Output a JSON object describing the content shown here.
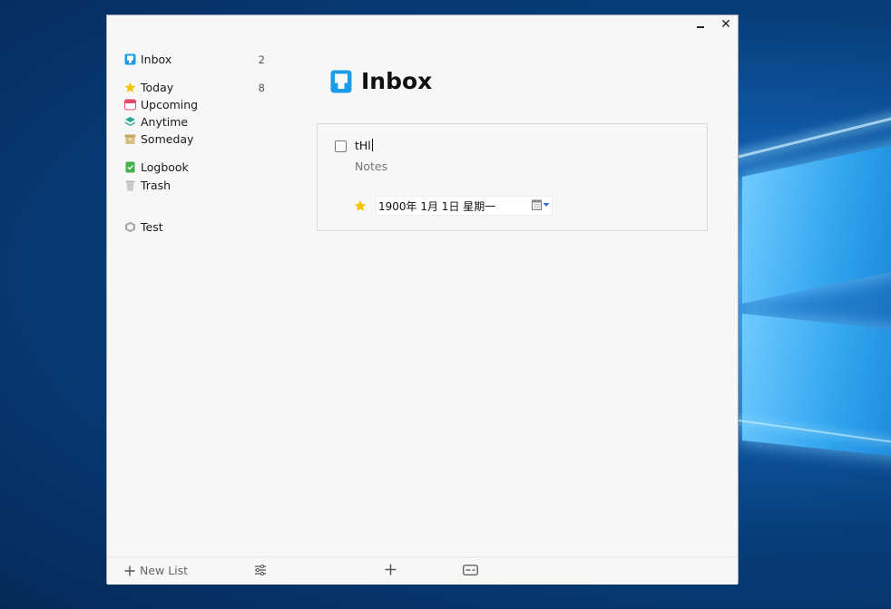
{
  "window": {
    "minimize_label": "_",
    "close_label": "✕"
  },
  "sidebar": {
    "items": [
      {
        "label": "Inbox",
        "count": "2",
        "icon": "inbox-icon"
      },
      {
        "label": "Today",
        "count": "8",
        "icon": "star-icon"
      },
      {
        "label": "Upcoming",
        "count": "",
        "icon": "calendar-icon"
      },
      {
        "label": "Anytime",
        "count": "",
        "icon": "layers-icon"
      },
      {
        "label": "Someday",
        "count": "",
        "icon": "archive-box-icon"
      },
      {
        "label": "Logbook",
        "count": "",
        "icon": "logbook-icon"
      },
      {
        "label": "Trash",
        "count": "",
        "icon": "trash-icon"
      },
      {
        "label": "Test",
        "count": "",
        "icon": "area-cube-icon"
      }
    ]
  },
  "main": {
    "title": "Inbox",
    "task": {
      "title": "tHl",
      "notes_placeholder": "Notes",
      "date": "1900年  1月  1日 星期一"
    }
  },
  "footer": {
    "new_list_label": "New List"
  },
  "colors": {
    "inbox_blue": "#1e9be8",
    "today_yellow": "#f5c400",
    "upcoming_red": "#e8476a",
    "anytime_teal": "#2aa58f",
    "someday_tan": "#c9a866",
    "logbook_green": "#46b04a"
  }
}
